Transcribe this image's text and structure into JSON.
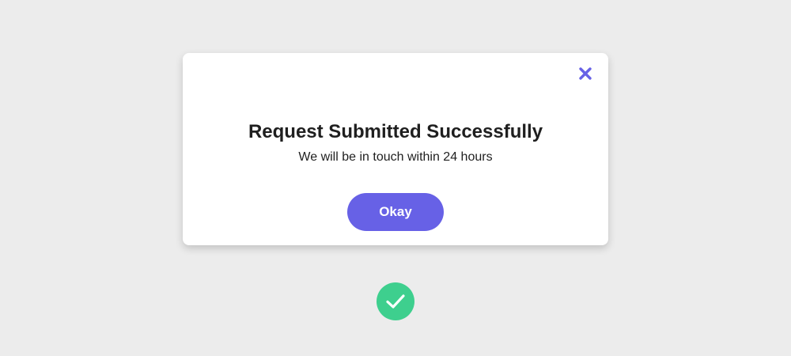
{
  "colors": {
    "background": "#ececec",
    "accent": "#6761e6",
    "success": "#3ecf8e",
    "text": "#1f1f1f"
  },
  "modal": {
    "close_icon": "close-icon",
    "title": "Request Submitted Successfully",
    "message": "We will be in touch within 24 hours",
    "okay_label": "Okay"
  },
  "status": {
    "icon": "check-circle-icon"
  }
}
